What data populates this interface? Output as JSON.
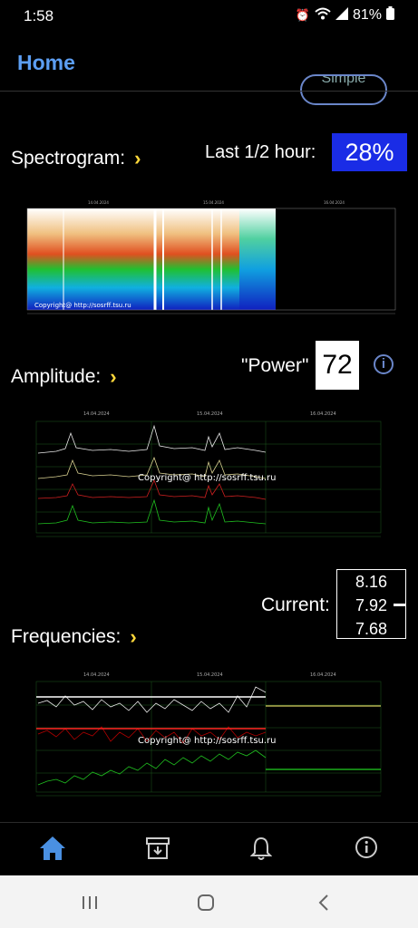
{
  "status_bar": {
    "time": "1:58",
    "battery": "81%"
  },
  "appbar": {
    "title": "Home"
  },
  "simple_button": {
    "label": "Simple"
  },
  "spectrogram": {
    "label": "Spectrogram:",
    "last_label": "Last 1/2 hour:",
    "percent": "28%",
    "dates": [
      "14.04.2024",
      "15.04.2024",
      "16.04.2024"
    ],
    "copyright": "Copyright@ http://sosrff.tsu.ru"
  },
  "amplitude": {
    "label": "Amplitude:",
    "power_label": "\"Power\"",
    "power_value": "72",
    "dates": [
      "14.04.2024",
      "15.04.2024",
      "16.04.2024"
    ],
    "copyright": "Copyright@ http://sosrff.tsu.ru"
  },
  "frequencies": {
    "label": "Frequencies:",
    "current_label": "Current:",
    "current_values": [
      "8.16",
      "7.92",
      "7.68"
    ],
    "dates": [
      "14.04.2024",
      "15.04.2024",
      "16.04.2024"
    ],
    "copyright": "Copyright@ http://sosrff.tsu.ru"
  },
  "bottom_nav": {
    "items": [
      "home-icon",
      "archive-icon",
      "bell-icon",
      "info-icon"
    ],
    "active": "home-icon"
  },
  "colors": {
    "accent": "#5c9ef3",
    "chevron": "#ffd93b",
    "percent_bg": "#1a2ce6"
  }
}
